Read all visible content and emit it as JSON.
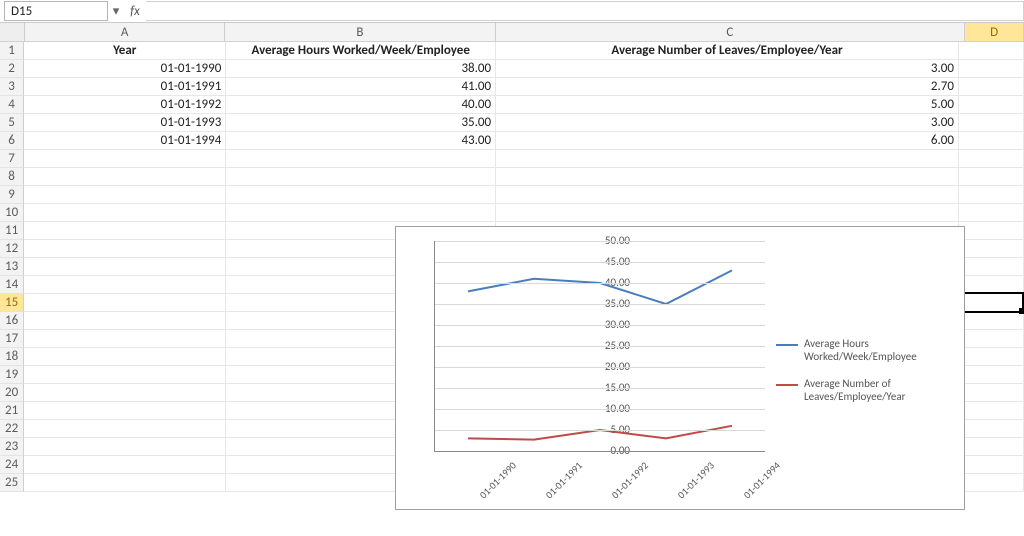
{
  "name_box": "D15",
  "fx_label": "fx",
  "formula_value": "",
  "columns": [
    "A",
    "B",
    "C",
    "D"
  ],
  "headers": {
    "A": "Year",
    "B": "Average Hours Worked/Week/Employee",
    "C": "Average Number of Leaves/Employee/Year"
  },
  "rows": [
    {
      "A": "01-01-1990",
      "B": "38.00",
      "C": "3.00"
    },
    {
      "A": "01-01-1991",
      "B": "41.00",
      "C": "2.70"
    },
    {
      "A": "01-01-1992",
      "B": "40.00",
      "C": "5.00"
    },
    {
      "A": "01-01-1993",
      "B": "35.00",
      "C": "3.00"
    },
    {
      "A": "01-01-1994",
      "B": "43.00",
      "C": "6.00"
    }
  ],
  "selected_cell": "D15",
  "chart_data": {
    "type": "line",
    "categories": [
      "01-01-1990",
      "01-01-1991",
      "01-01-1992",
      "01-01-1993",
      "01-01-1994"
    ],
    "series": [
      {
        "name": "Average Hours Worked/Week/Employee",
        "color": "#4a7ebb",
        "values": [
          38.0,
          41.0,
          40.0,
          35.0,
          43.0
        ]
      },
      {
        "name": "Average Number of Leaves/Employee/Year",
        "color": "#be4b48",
        "values": [
          3.0,
          2.7,
          5.0,
          3.0,
          6.0
        ]
      }
    ],
    "ylim": [
      0,
      50
    ],
    "ystep": 5,
    "yticks": [
      "0.00",
      "5.00",
      "10.00",
      "15.00",
      "20.00",
      "25.00",
      "30.00",
      "35.00",
      "40.00",
      "45.00",
      "50.00"
    ]
  },
  "colors": {
    "series1": "#4a7ebb",
    "series2": "#be4b48"
  }
}
